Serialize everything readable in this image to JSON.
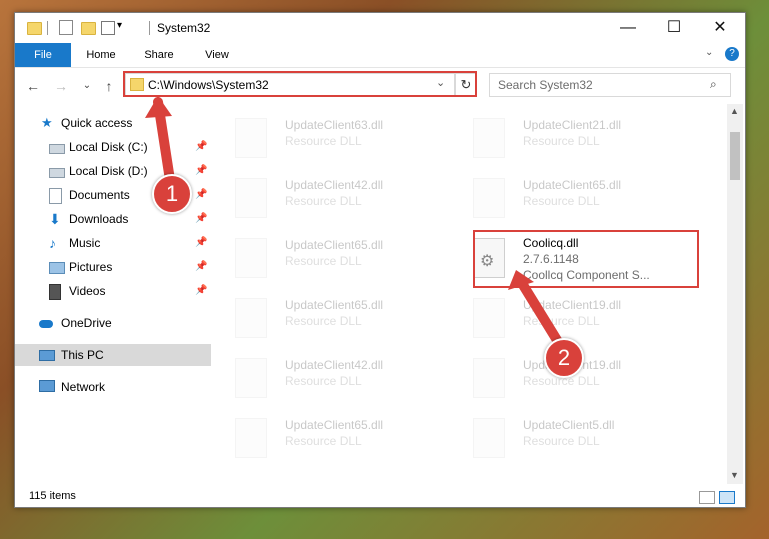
{
  "window": {
    "title": "System32"
  },
  "ribbon": {
    "tabs": [
      "File",
      "Home",
      "Share",
      "View"
    ]
  },
  "address": {
    "path": "C:\\Windows\\System32"
  },
  "search": {
    "placeholder": "Search System32"
  },
  "nav": {
    "items": [
      {
        "label": "Quick access"
      },
      {
        "label": "Local Disk (C:)"
      },
      {
        "label": "Local Disk (D:)"
      },
      {
        "label": "Documents"
      },
      {
        "label": "Downloads"
      },
      {
        "label": "Music"
      },
      {
        "label": "Pictures"
      },
      {
        "label": "Videos"
      },
      {
        "label": "OneDrive"
      },
      {
        "label": "This PC"
      },
      {
        "label": "Network"
      }
    ]
  },
  "files": [
    {
      "name": "UpdateClient63.dll",
      "sub": "Resource DLL"
    },
    {
      "name": "UpdateClient21.dll",
      "sub": "Resource DLL"
    },
    {
      "name": "UpdateClient42.dll",
      "sub": "Resource DLL"
    },
    {
      "name": "UpdateClient65.dll",
      "sub": "Resource DLL"
    },
    {
      "name": "UpdateClient65.dll",
      "sub": "Resource DLL"
    },
    {
      "name": "Coolicq.dll",
      "sub": "2.7.6.1148",
      "sub2": "Coollcq Component S..."
    },
    {
      "name": "UpdateClient65.dll",
      "sub": "Resource DLL"
    },
    {
      "name": "UpdateClient19.dll",
      "sub": "Resource DLL"
    },
    {
      "name": "UpdateClient42.dll",
      "sub": "Resource DLL"
    },
    {
      "name": "UpdateClient19.dll",
      "sub": "Resource DLL"
    },
    {
      "name": "UpdateClient65.dll",
      "sub": "Resource DLL"
    },
    {
      "name": "UpdateClient5.dll",
      "sub": "Resource DLL"
    }
  ],
  "status": {
    "count": "115 items"
  },
  "callouts": [
    "1",
    "2"
  ],
  "colors": {
    "accent": "#1979ca",
    "highlight": "#d9413b"
  }
}
